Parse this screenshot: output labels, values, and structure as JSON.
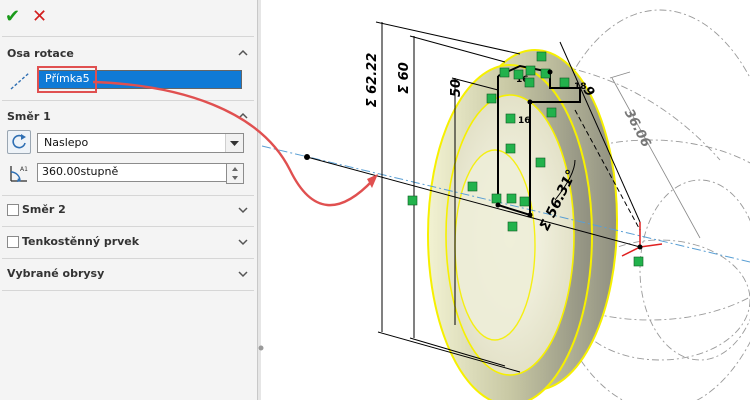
{
  "toolbar": {
    "ok_symbol": "✔",
    "cancel_symbol": "✕"
  },
  "sections": {
    "osa_rotace": {
      "title": "Osa rotace",
      "axis_value": "Přímka5"
    },
    "smer1": {
      "title": "Směr 1",
      "type_selected": "Naslepo",
      "angle_value": "360.00stupně"
    },
    "smer2": {
      "title": "Směr 2"
    },
    "thin": {
      "title": "Tenkostěnný prvek"
    },
    "contours": {
      "title": "Vybrané obrysy"
    }
  },
  "dimensions": {
    "d1": "Σ 62.22",
    "d2": "Σ 60",
    "d3": "50",
    "d4": "36.06",
    "d5": "Σ 56.31°",
    "d6": "9",
    "r1": "16",
    "r2": "16",
    "r3": "18"
  },
  "colors": {
    "accent_blue": "#0f7ad6",
    "highlight_red": "#e05050",
    "ok_green": "#1a9a1a",
    "cancel_red": "#d21f1f",
    "body_yellow": "#f6f000",
    "relation_green": "#22b24c",
    "centerline_blue": "#5a9fd4"
  },
  "icons": {
    "ok": "check-icon",
    "cancel": "close-icon",
    "axis": "axis-line-icon",
    "direction": "reverse-direction-icon",
    "angle": "angle-icon"
  }
}
